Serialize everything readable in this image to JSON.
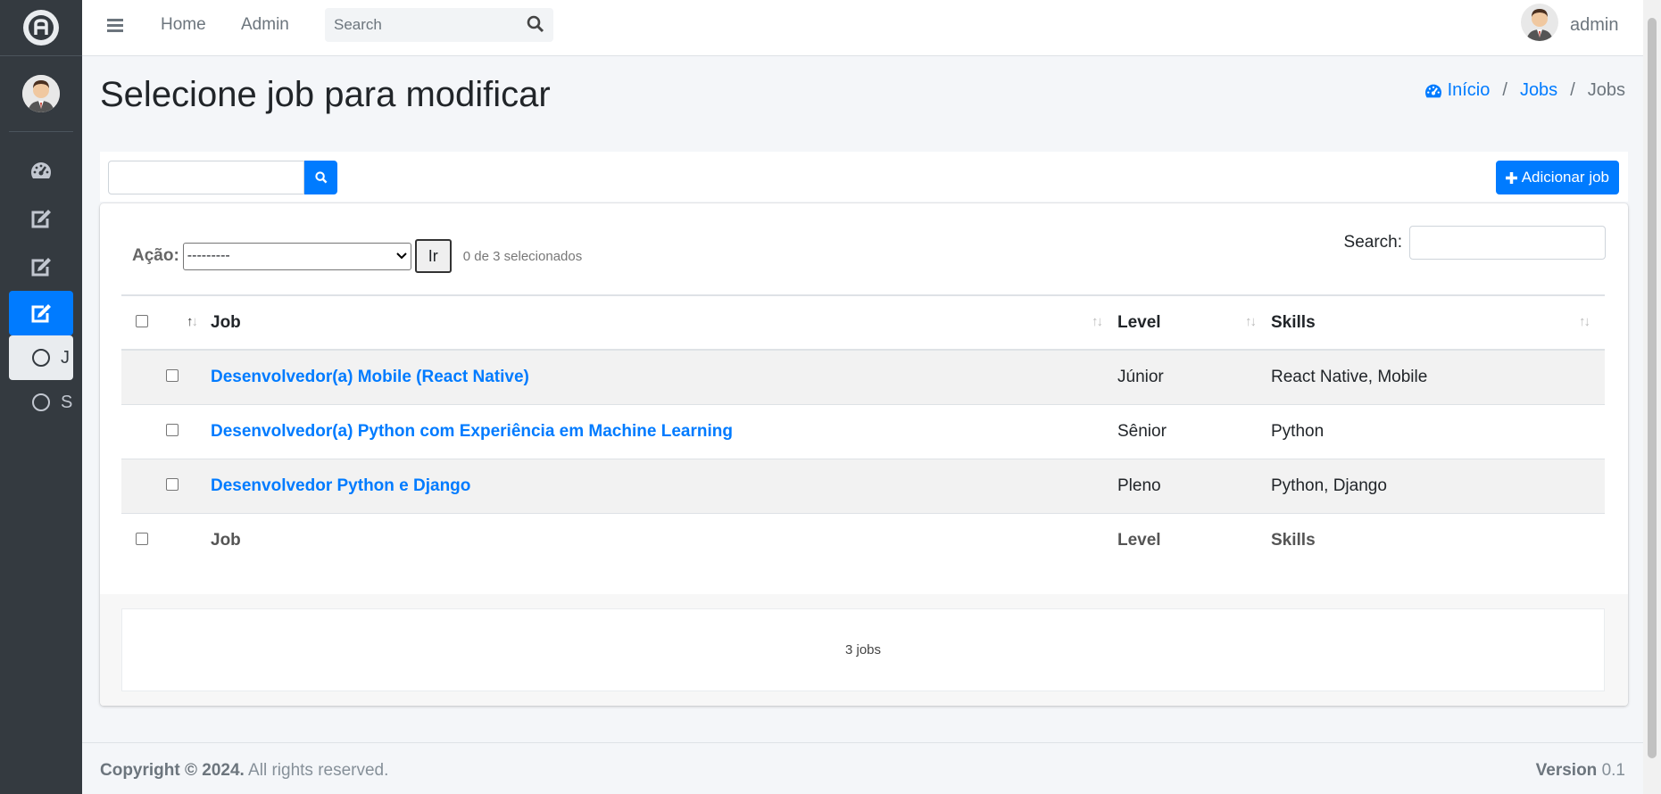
{
  "sidebar": {
    "logo_icon": "adminlte-logo-icon",
    "items": [
      {
        "icon": "tachometer-icon"
      },
      {
        "icon": "edit-icon"
      },
      {
        "icon": "edit-icon"
      },
      {
        "icon": "edit-icon",
        "active": true
      }
    ],
    "subitems": [
      {
        "label": "J",
        "active": true
      },
      {
        "label": "S",
        "active": false
      }
    ]
  },
  "navbar": {
    "links": [
      "Home",
      "Admin"
    ],
    "search_placeholder": "Search",
    "user": "admin"
  },
  "page": {
    "title": "Selecione job para modificar",
    "breadcrumb": [
      "Início",
      "Jobs",
      "Jobs"
    ]
  },
  "toolbar": {
    "add_label": "Adicionar job"
  },
  "changelist": {
    "action_label": "Ação:",
    "action_selected": "---------",
    "go_label": "Ir",
    "counter": "0 de 3 selecionados",
    "search_label": "Search:",
    "columns": [
      "Job",
      "Level",
      "Skills"
    ],
    "rows": [
      {
        "job": "Desenvolvedor(a) Mobile (React Native)",
        "level": "Júnior",
        "skills": "React Native, Mobile"
      },
      {
        "job": "Desenvolvedor(a) Python com Experiência em Machine Learning",
        "level": "Sênior",
        "skills": "Python"
      },
      {
        "job": "Desenvolvedor Python e Django",
        "level": "Pleno",
        "skills": "Python, Django"
      }
    ],
    "paginator": "3 jobs"
  },
  "footer": {
    "copyright_bold": "Copyright © 2024.",
    "copyright_rest": " All rights reserved.",
    "version_label": "Version",
    "version": " 0.1"
  },
  "colors": {
    "sidebar_bg": "#343a40",
    "primary": "#007bff",
    "content_bg": "#f4f6f9"
  }
}
